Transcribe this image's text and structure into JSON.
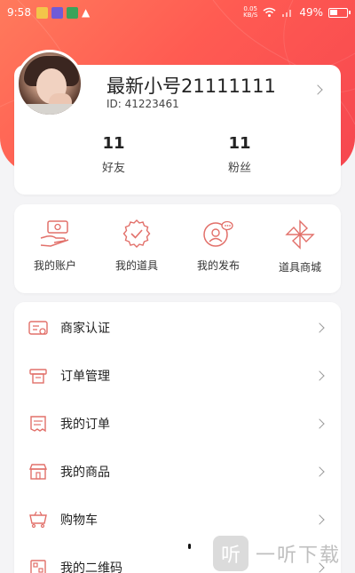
{
  "status_bar": {
    "time": "9:58",
    "net_speed_value": "0.05",
    "net_speed_unit": "KB/S",
    "battery": "49%"
  },
  "profile": {
    "username": "最新小号21111111",
    "id_text": "ID: 41223461",
    "friends_count": "11",
    "friends_label": "好友",
    "fans_count": "11",
    "fans_label": "粉丝"
  },
  "grid": [
    {
      "label": "我的账户",
      "icon": "wallet-hand-icon"
    },
    {
      "label": "我的道具",
      "icon": "badge-check-icon"
    },
    {
      "label": "我的发布",
      "icon": "person-chat-icon"
    },
    {
      "label": "道具商城",
      "icon": "pinwheel-icon"
    }
  ],
  "menu": [
    {
      "label": "商家认证",
      "icon": "id-card-icon"
    },
    {
      "label": "订单管理",
      "icon": "printer-icon"
    },
    {
      "label": "我的订单",
      "icon": "receipt-icon"
    },
    {
      "label": "我的商品",
      "icon": "store-icon"
    },
    {
      "label": "购物车",
      "icon": "cart-icon"
    },
    {
      "label": "我的二维码",
      "icon": "qrcode-icon"
    }
  ],
  "watermark": {
    "badge": "听",
    "text": "一听下载"
  },
  "colors": {
    "header_gradient_start": "#ff7a5c",
    "header_gradient_end": "#f6464f",
    "icon_accent": "#e2706a"
  }
}
